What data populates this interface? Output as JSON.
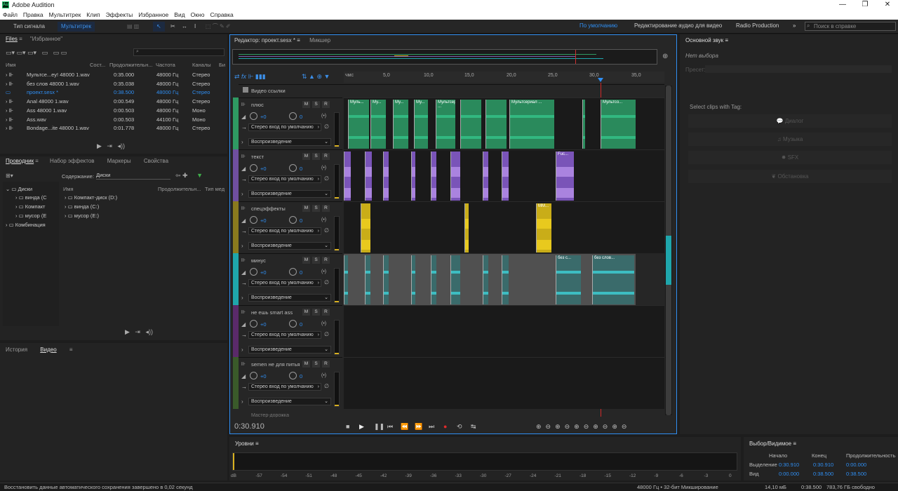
{
  "app": {
    "title": "Adobe Audition",
    "logo": "Au"
  },
  "menu": [
    "Файл",
    "Правка",
    "Мультитрек",
    "Клип",
    "Эффекты",
    "Избранное",
    "Вид",
    "Окно",
    "Справка"
  ],
  "toolbar": {
    "mode_waveform": "Тип сигнала",
    "mode_multitrack": "Мультитрек"
  },
  "workspaces": {
    "default": "По умолчанию",
    "edit_video": "Редактирование аудио для видео",
    "radio": "Radio Production"
  },
  "search": {
    "placeholder": "Поиск в справке"
  },
  "files_panel": {
    "tab_files": "Files",
    "tab_favorites": "\"Избранное\"",
    "columns": [
      "Имя",
      "Сост...",
      "Продолжительн...",
      "Частота",
      "Каналы",
      "Би"
    ],
    "rows": [
      {
        "name": "Мультсе...ey! 48000 1.wav",
        "dur": "0:35.000",
        "rate": "48000 Гц",
        "ch": "Стерео"
      },
      {
        "name": "без слов 48000 1.wav",
        "dur": "0:35.038",
        "rate": "48000 Гц",
        "ch": "Стерео"
      },
      {
        "name": "проект.sesx *",
        "dur": "0:38.500",
        "rate": "48000 Гц",
        "ch": "Стерео"
      },
      {
        "name": "Anal 48000 1.wav",
        "dur": "0:00.549",
        "rate": "48000 Гц",
        "ch": "Стерео"
      },
      {
        "name": "Ass 48000 1.wav",
        "dur": "0:00.503",
        "rate": "48000 Гц",
        "ch": "Моно"
      },
      {
        "name": "Ass.wav",
        "dur": "0:00.503",
        "rate": "44100 Гц",
        "ch": "Моно"
      },
      {
        "name": "Bondage...ite 48000 1.wav",
        "dur": "0:01.778",
        "rate": "48000 Гц",
        "ch": "Стерео"
      }
    ]
  },
  "explorer": {
    "tabs": [
      "Проводник",
      "Набор эффектов",
      "Маркеры",
      "Свойства"
    ],
    "content_label": "Содержание:",
    "content_value": "Диски",
    "tree": [
      "Диски",
      "винда (C",
      "Компакт",
      "мусор (E",
      "Комбинация"
    ],
    "list_header": [
      "Имя",
      "Продолжительн...",
      "Тип мед"
    ],
    "list": [
      "Компакт-диск (D:)",
      "винда (C:)",
      "мусор (E:)"
    ]
  },
  "history": {
    "tab_history": "История",
    "tab_video": "Видео"
  },
  "editor": {
    "tab_editor": "Редактор: проект.sesx *",
    "tab_mixer": "Микшер",
    "ruler_ticks": [
      "чмс",
      "5,0",
      "10,0",
      "15,0",
      "20,0",
      "25,0",
      "30,0",
      "35,0"
    ],
    "video_track": "Видео ссылки",
    "time": "0:30.910",
    "tracks": [
      {
        "name": "плюс",
        "vol": "+0",
        "pan": "0",
        "input": "Стерео вход по умолчанию",
        "output": "Воспроизведение",
        "color": "#2f9a63"
      },
      {
        "name": "текст",
        "vol": "+0",
        "pan": "0",
        "input": "Стерео вход по умолчанию",
        "output": "Воспроизведение",
        "color": "#6f4fa0"
      },
      {
        "name": "спецэффекты",
        "vol": "+0",
        "pan": "0",
        "input": "Стерео вход по умолчанию",
        "output": "Воспроизведение",
        "color": "#8a7a1e"
      },
      {
        "name": "минус",
        "vol": "+0",
        "pan": "0",
        "input": "Стерео вход по умолчанию",
        "output": "Воспроизведение",
        "color": "#1fa6ac"
      },
      {
        "name": "не ешь smart ass",
        "vol": "+0",
        "pan": "0",
        "input": "Стерео вход по умолчанию",
        "output": "Воспроизведение",
        "color": "#5a2a6a"
      },
      {
        "name": "semen не для питья",
        "vol": "+0",
        "pan": "0",
        "input": "Стерео вход по умолчанию",
        "output": "Воспроизведение",
        "color": "#3a5a2a"
      }
    ],
    "clip_labels": {
      "t1a": "Муль...",
      "t1b": "Му...",
      "t1c": "Му...",
      "t1d": "Му...",
      "t1e": "Мультсериал ...",
      "t1f": "Мультсо...",
      "t2a": "Fuc...",
      "t3a": "ММ...",
      "t4a": "без с...",
      "t4b": "без слов..."
    },
    "next_track": "Мастер-дорожка"
  },
  "essential_sound": {
    "title": "Основной звук",
    "no_selection": "Нет выбора",
    "preset": "Пресет:",
    "select_tag": "Select clips with Tag:",
    "buttons": [
      "Диалог",
      "Музыка",
      "SFX",
      "Обстановка"
    ]
  },
  "levels": {
    "title": "Уровни",
    "scale": [
      "dB",
      "-57",
      "-54",
      "-51",
      "-48",
      "-45",
      "-42",
      "-39",
      "-36",
      "-33",
      "-30",
      "-27",
      "-24",
      "-21",
      "-18",
      "-15",
      "-12",
      "-9",
      "-6",
      "-3",
      "0"
    ]
  },
  "selection": {
    "title": "Выбор/Видимое",
    "headers": [
      "Начало",
      "Конец",
      "Продолжительность"
    ],
    "sel_label": "Выделение",
    "sel": [
      "0:30.910",
      "0:30.910",
      "0:00.000"
    ],
    "view_label": "Вид",
    "view": [
      "0:00.000",
      "0:38.500",
      "0:38.500"
    ]
  },
  "status": {
    "message": "Восстановить данные автоматического сохранения завершено в 0,02 секунд",
    "format": "48000 Гц • 32-бит Микширование",
    "size": "14,10 мБ",
    "duration": "0:38.500",
    "free": "783,76 ГБ свободно"
  }
}
